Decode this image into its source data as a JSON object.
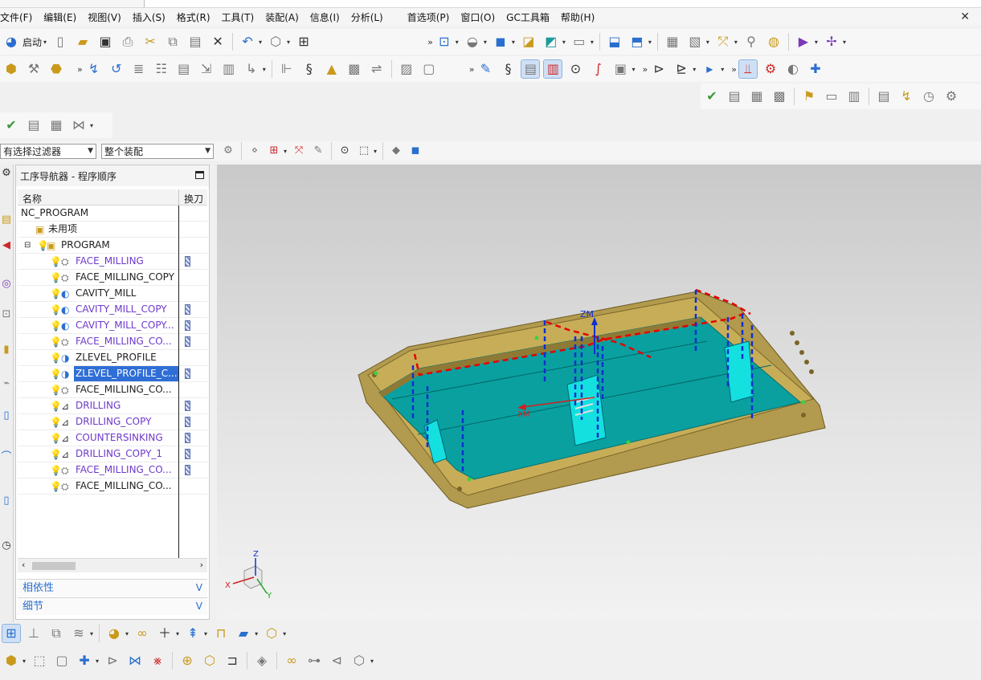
{
  "menubar": {
    "items": [
      "文件(F)",
      "编辑(E)",
      "视图(V)",
      "插入(S)",
      "格式(R)",
      "工具(T)",
      "装配(A)",
      "信息(I)",
      "分析(L)",
      "首选项(P)",
      "窗口(O)",
      "GC工具箱",
      "帮助(H)"
    ]
  },
  "toolbar": {
    "start_label": "启动"
  },
  "filters": {
    "selection_filter": "有选择过滤器",
    "assembly_scope": "整个装配"
  },
  "navigator": {
    "title": "工序导航器 - 程序顺序",
    "col_name": "名称",
    "col_tool": "换刀",
    "rows": [
      {
        "label": "NC_PROGRAM"
      },
      {
        "label": "未用项"
      },
      {
        "label": "PROGRAM"
      },
      {
        "label": "FACE_MILLING"
      },
      {
        "label": "FACE_MILLING_COPY"
      },
      {
        "label": "CAVITY_MILL"
      },
      {
        "label": "CAVITY_MILL_COPY"
      },
      {
        "label": "CAVITY_MILL_COPY..."
      },
      {
        "label": "FACE_MILLING_CO..."
      },
      {
        "label": "ZLEVEL_PROFILE"
      },
      {
        "label": "ZLEVEL_PROFILE_C..."
      },
      {
        "label": "FACE_MILLING_CO..."
      },
      {
        "label": "DRILLING"
      },
      {
        "label": "DRILLING_COPY"
      },
      {
        "label": "COUNTERSINKING"
      },
      {
        "label": "DRILLING_COPY_1"
      },
      {
        "label": "FACE_MILLING_CO..."
      },
      {
        "label": "FACE_MILLING_CO..."
      }
    ],
    "accordion": {
      "dependencies": "相依性",
      "details": "细节"
    }
  },
  "viewport": {
    "csys_zm": "ZM",
    "csys_xm": "XM",
    "triad": {
      "x": "X",
      "y": "Y",
      "z": "Z"
    }
  },
  "colors": {
    "part_body": "#b29a4e",
    "floor": "#0aa0a0",
    "toolpath_rapid": "#e60000",
    "toolpath_feed": "#1030d0",
    "selection": "#2f6ed6"
  }
}
